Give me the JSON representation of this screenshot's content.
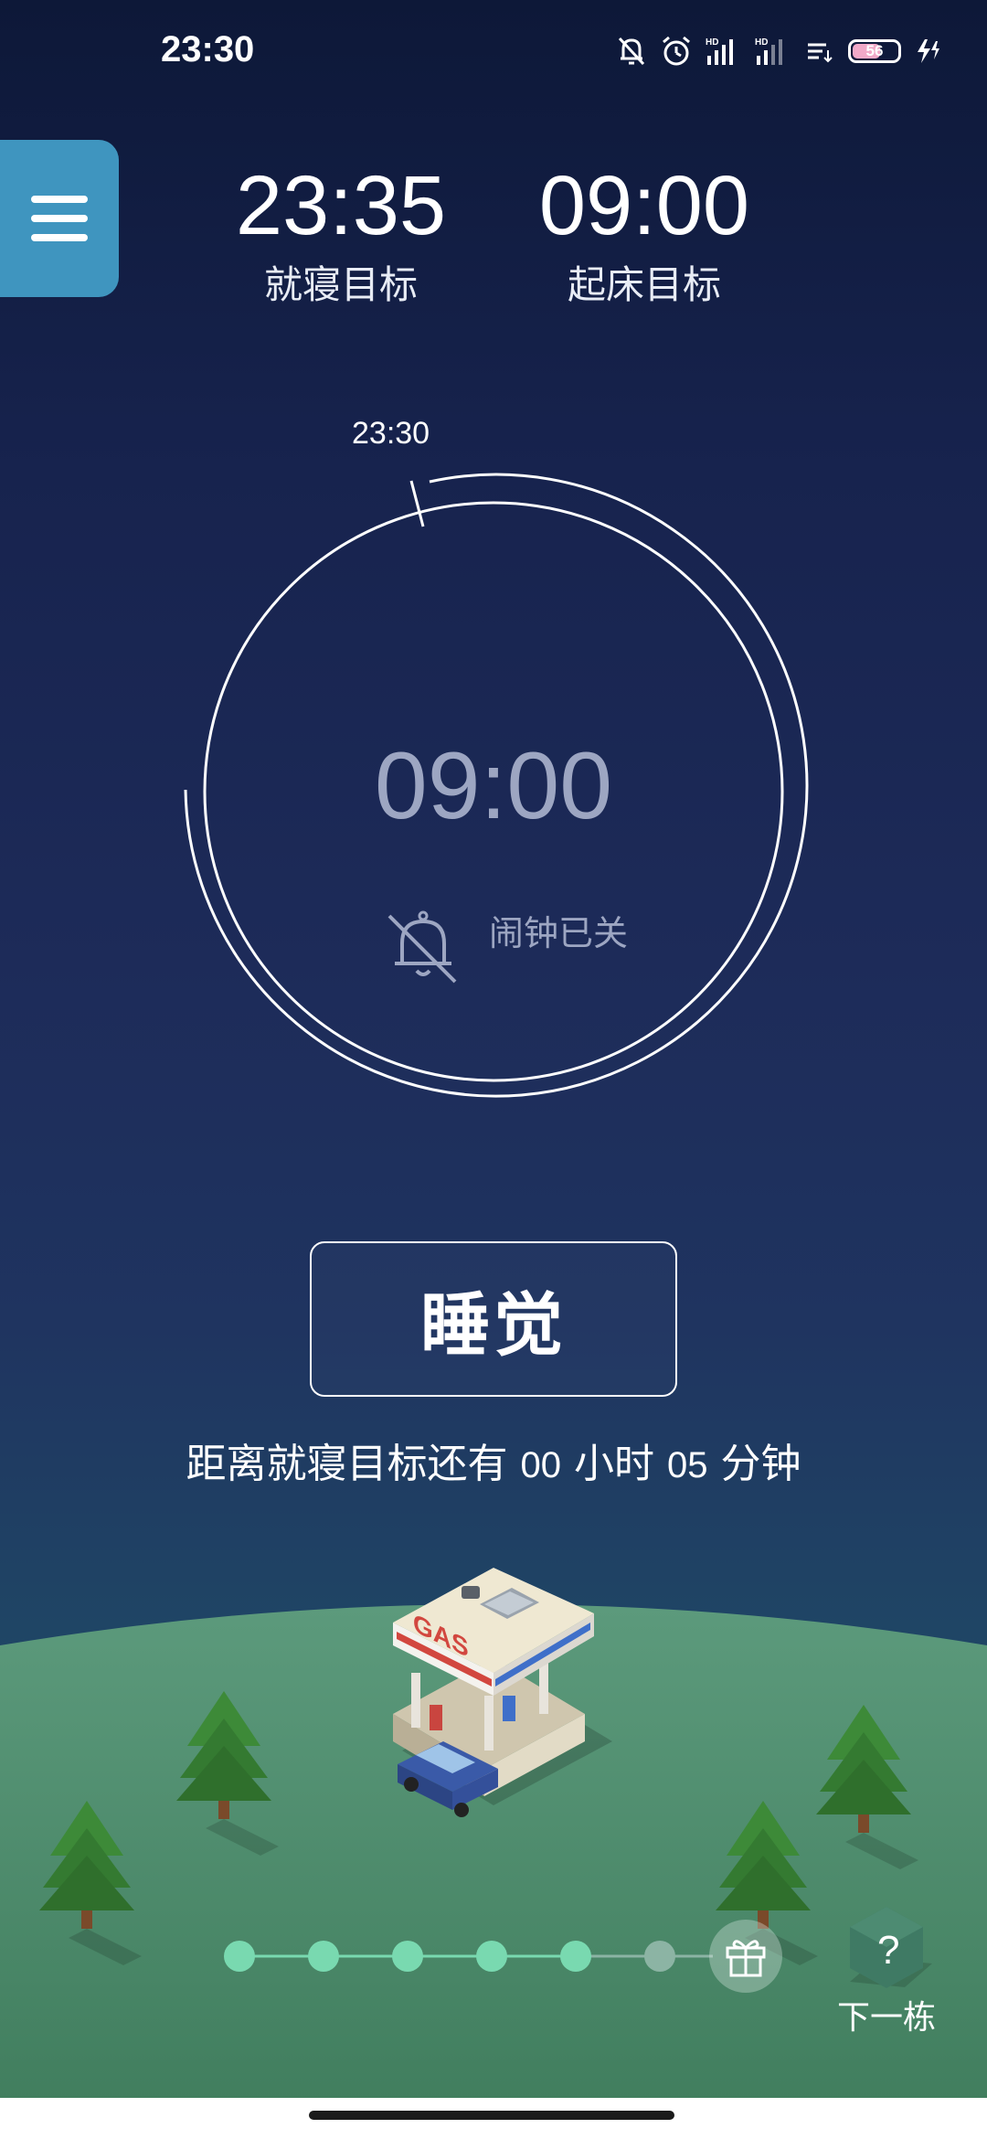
{
  "status_bar": {
    "time": "23:30",
    "battery_level": "56",
    "icons": [
      "bell-off-icon",
      "alarm-clock-icon",
      "hd-signal-icon",
      "hd-signal-icon",
      "network-speed-icon",
      "battery-icon",
      "charging-icon"
    ]
  },
  "menu": {
    "icon": "hamburger-menu-icon"
  },
  "targets": {
    "bedtime": {
      "time": "23:35",
      "label": "就寝目标"
    },
    "wake": {
      "time": "09:00",
      "label": "起床目标"
    }
  },
  "dial": {
    "current_time_label": "23:30",
    "alarm_time": "09:00",
    "alarm_status": "闹钟已关",
    "alarm_icon": "bell-off-icon"
  },
  "sleep_button": {
    "label": "睡觉"
  },
  "countdown": {
    "prefix": "距离就寝目标还有",
    "hours": "00",
    "hours_unit": "小时",
    "minutes": "05",
    "minutes_unit": "分钟"
  },
  "progress": {
    "completed_steps": 5,
    "total_steps": 6,
    "reward_icon": "gift-icon",
    "colors": {
      "done": "#79d9b0",
      "pending": "#8cb4a4"
    }
  },
  "next_building": {
    "label": "下一栋",
    "icon": "mystery-house-icon",
    "symbol": "?"
  },
  "scene": {
    "building_sign": "GAS"
  },
  "colors": {
    "menu_button": "#3f95bf",
    "ground": "#4f8c6d",
    "dial_muted_text": "#9da6c2"
  }
}
